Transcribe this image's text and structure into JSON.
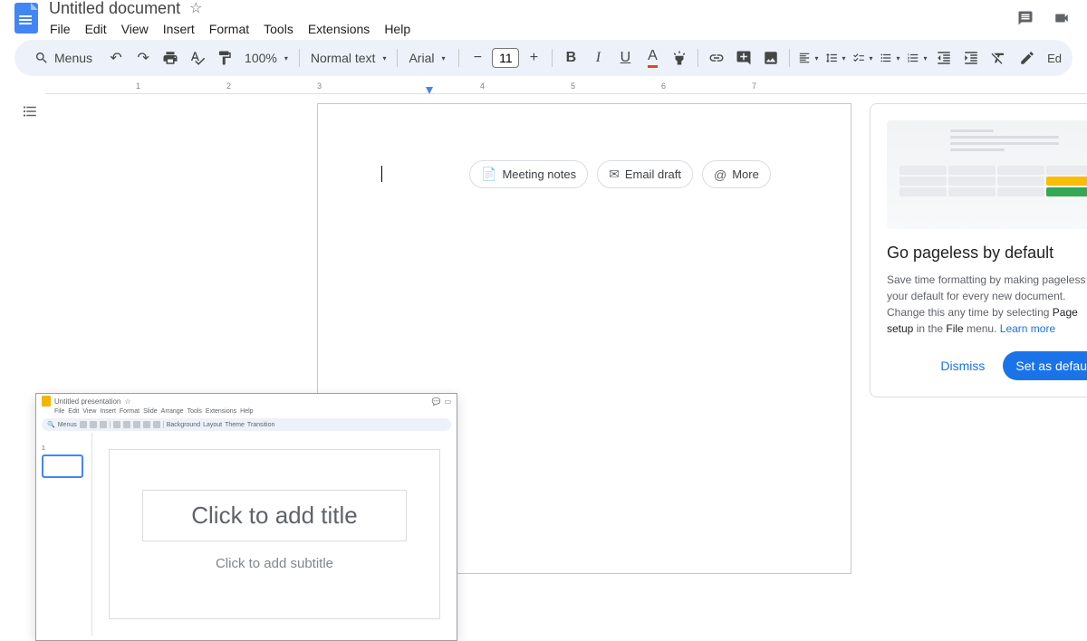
{
  "header": {
    "title": "Untitled document",
    "menus": [
      "File",
      "Edit",
      "View",
      "Insert",
      "Format",
      "Tools",
      "Extensions",
      "Help"
    ]
  },
  "toolbar": {
    "menus_label": "Menus",
    "zoom": "100%",
    "style": "Normal text",
    "font": "Arial",
    "font_size": "11",
    "edit_mode": "Editing"
  },
  "ruler": {
    "marks": [
      "1",
      "2",
      "3",
      "4",
      "5",
      "6",
      "7"
    ]
  },
  "chips": {
    "meeting": "Meeting notes",
    "email": "Email draft",
    "more": "More"
  },
  "pageless": {
    "title": "Go pageless by default",
    "body_start": "Save time formatting by making pageless your default for every new document. Change this any time by selecting ",
    "body_bold1": "Page setup",
    "body_mid": " in the ",
    "body_bold2": "File",
    "body_end": " menu. ",
    "learn": "Learn more",
    "dismiss": "Dismiss",
    "set": "Set as default"
  },
  "slides": {
    "title": "Untitled presentation",
    "menus": [
      "File",
      "Edit",
      "View",
      "Insert",
      "Format",
      "Slide",
      "Arrange",
      "Tools",
      "Extensions",
      "Help"
    ],
    "menus_label": "Menus",
    "tool_opts": [
      "Background",
      "Layout",
      "Theme",
      "Transition"
    ],
    "title_placeholder": "Click to add title",
    "subtitle_placeholder": "Click to add subtitle"
  }
}
